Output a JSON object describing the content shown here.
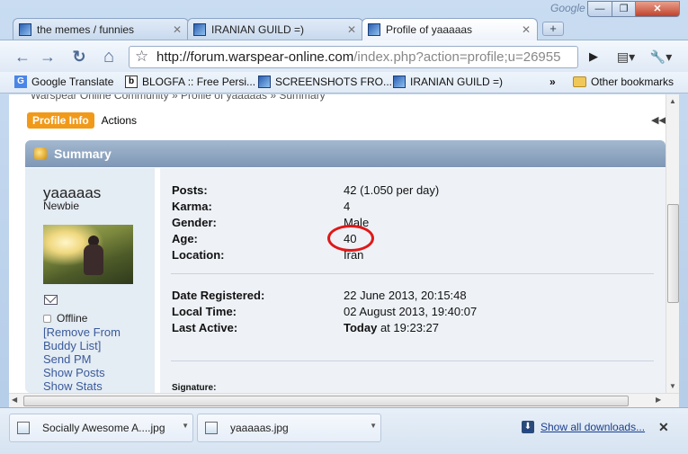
{
  "window": {
    "google_label": "Google",
    "min_glyph": "—",
    "max_glyph": "❐",
    "close_glyph": "✕"
  },
  "tabs": [
    {
      "title": "the memes / funnies",
      "active": false
    },
    {
      "title": "IRANIAN GUILD =)",
      "active": false
    },
    {
      "title": "Profile of yaaaaas",
      "active": true
    }
  ],
  "new_tab_glyph": "+",
  "toolbar": {
    "back_glyph": "←",
    "forward_glyph": "→",
    "reload_glyph": "↻",
    "home_glyph": "⌂",
    "star_glyph": "☆",
    "url_host": "http://forum.warspear-online.com",
    "url_path": "/index.php?action=profile;u=26955",
    "go_glyph": "▶",
    "page_glyph": "▤▾",
    "wrench_glyph": "🔧▾"
  },
  "bookmarks": {
    "items": [
      {
        "label": "Google Translate",
        "icon": "google-translate-icon"
      },
      {
        "label": "BLOGFA :: Free Persi...",
        "icon": "blogfa-icon"
      },
      {
        "label": "SCREENSHOTS FRO...",
        "icon": "warspear-icon"
      },
      {
        "label": "IRANIAN GUILD =)",
        "icon": "warspear-icon"
      }
    ],
    "overflow_glyph": "»",
    "other_label": "Other bookmarks"
  },
  "page": {
    "breadcrumb": "Warspear Online Community » Profile of yaaaaas » Summary",
    "tab_profile_info": "Profile Info",
    "tab_actions": "Actions",
    "collapse_glyph": "◀◀",
    "summary_title": "Summary",
    "user": {
      "name": "yaaaaas",
      "title": "Newbie",
      "status": "Offline",
      "links": [
        "[Remove From",
        "Buddy List]",
        "Send PM",
        "Show Posts",
        "Show Stats"
      ]
    },
    "fields_1": [
      {
        "label": "Posts:",
        "value": "42 (1.050 per day)"
      },
      {
        "label": "Karma:",
        "value": "4"
      },
      {
        "label": "Gender:",
        "value": "Male"
      },
      {
        "label": "Age:",
        "value": "40"
      },
      {
        "label": "Location:",
        "value": "Iran"
      }
    ],
    "fields_2": [
      {
        "label": "Date Registered:",
        "value": "22 June 2013, 20:15:48"
      },
      {
        "label": "Local Time:",
        "value": "02 August 2013, 19:40:07"
      },
      {
        "label": "Last Active:",
        "value_bold": "Today",
        "value": " at 19:23:27"
      }
    ],
    "signature_label": "Signature:"
  },
  "downloads": {
    "items": [
      "Socially Awesome A....jpg",
      "yaaaaas.jpg"
    ],
    "show_all": "Show all downloads...",
    "close_glyph": "✕"
  }
}
